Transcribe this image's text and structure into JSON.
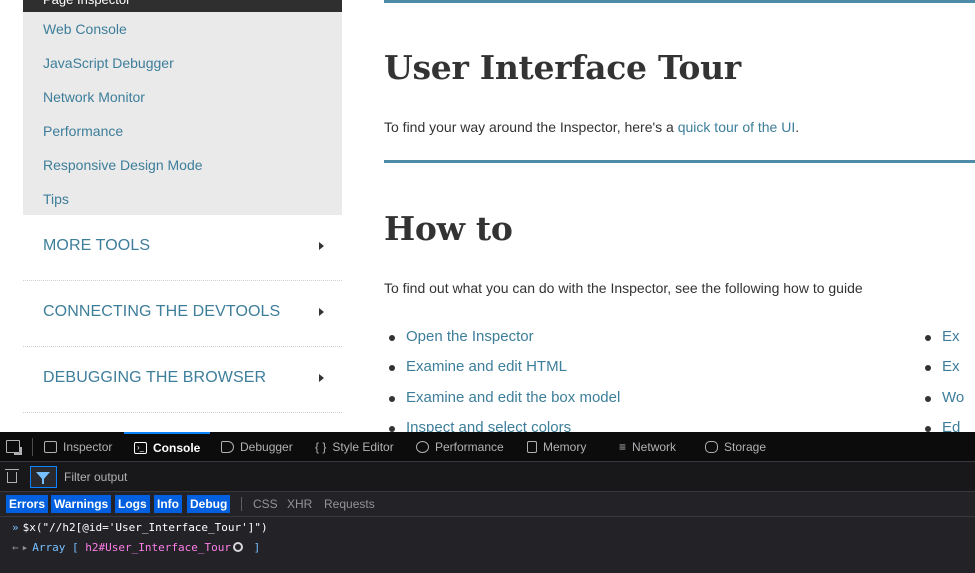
{
  "sidebar": {
    "top_item": "Page Inspector",
    "sub_items": [
      "Web Console",
      "JavaScript Debugger",
      "Network Monitor",
      "Performance",
      "Responsive Design Mode",
      "Tips"
    ],
    "sections": [
      "MORE TOOLS",
      "CONNECTING THE DEVTOOLS",
      "DEBUGGING THE BROWSER"
    ]
  },
  "content": {
    "h1": "User Interface Tour",
    "p1_text": "To find your way around the Inspector, here's a ",
    "p1_link": "quick tour of the UI",
    "p1_end": ".",
    "h2": "How to",
    "p2_text": "To find out what you can do with the Inspector, see the following how to guide",
    "list_left": [
      "Open the Inspector",
      "Examine and edit HTML",
      "Examine and edit the box model",
      "Inspect and select colors"
    ],
    "list_right": [
      "Ex",
      "Ex",
      "Wo",
      "Ed"
    ]
  },
  "devtools": {
    "tabs": [
      {
        "label": "Inspector",
        "icon": "inspector-icon"
      },
      {
        "label": "Console",
        "icon": "console-icon"
      },
      {
        "label": "Debugger",
        "icon": "debugger-icon"
      },
      {
        "label": "Style Editor",
        "icon": "style-editor-icon",
        "glyph": "{ }"
      },
      {
        "label": "Performance",
        "icon": "performance-icon"
      },
      {
        "label": "Memory",
        "icon": "memory-icon"
      },
      {
        "label": "Network",
        "icon": "network-icon"
      },
      {
        "label": "Storage",
        "icon": "storage-icon"
      }
    ],
    "active_tab": "Console",
    "filter_placeholder": "Filter output",
    "levels_on": [
      "Errors",
      "Warnings",
      "Logs",
      "Info",
      "Debug"
    ],
    "levels_off": [
      "CSS",
      "XHR",
      "Requests"
    ],
    "input_line": "$x(\"//h2[@id='User_Interface_Tour']\")",
    "output": {
      "type": "Array",
      "open": "[",
      "tag": "h2",
      "id": "#User_Interface_Tour",
      "close": "]"
    },
    "accent_color": "#0a84ff"
  }
}
